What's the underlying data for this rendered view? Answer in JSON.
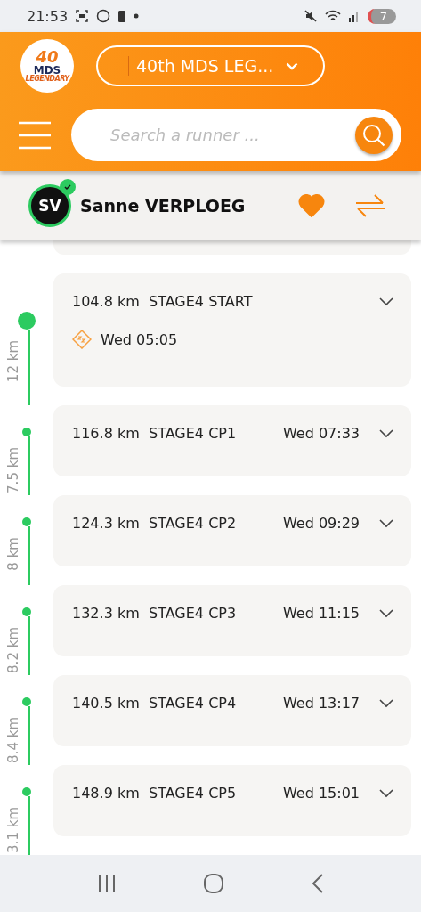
{
  "status_bar": {
    "time": "21:53",
    "notification_count": "7"
  },
  "header": {
    "logo": {
      "number": "40",
      "name": "MDS",
      "tagline": "LEGENDARY"
    },
    "event_select": {
      "value": "40th MDS LEG..."
    },
    "search": {
      "placeholder": "Search a runner ..."
    }
  },
  "runner": {
    "initials": "SV",
    "name": "Sanne VERPLOEG",
    "favorite": true
  },
  "timeline": [
    {
      "kind": "start",
      "distance": "104.8 km",
      "name": "STAGE4 START",
      "time": "Wed 05:05",
      "segment": "12 km"
    },
    {
      "kind": "checkpoint",
      "distance": "116.8 km",
      "name": "STAGE4 CP1",
      "time": "Wed 07:33",
      "segment": "7.5 km"
    },
    {
      "kind": "checkpoint",
      "distance": "124.3 km",
      "name": "STAGE4 CP2",
      "time": "Wed 09:29",
      "segment": "8 km"
    },
    {
      "kind": "checkpoint",
      "distance": "132.3 km",
      "name": "STAGE4 CP3",
      "time": "Wed 11:15",
      "segment": "8.2 km"
    },
    {
      "kind": "checkpoint",
      "distance": "140.5 km",
      "name": "STAGE4 CP4",
      "time": "Wed 13:17",
      "segment": "8.4 km"
    },
    {
      "kind": "checkpoint",
      "distance": "148.9 km",
      "name": "STAGE4 CP5",
      "time": "Wed 15:01",
      "segment": "3.1 km"
    }
  ]
}
